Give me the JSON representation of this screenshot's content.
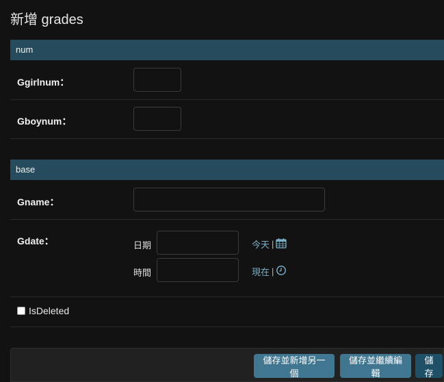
{
  "page": {
    "title": "新增 grades"
  },
  "sections": [
    {
      "header": "num",
      "fields": [
        {
          "label": "Ggirlnum：",
          "value": ""
        },
        {
          "label": "Gboynum：",
          "value": ""
        }
      ]
    },
    {
      "header": "base",
      "fields": [
        {
          "label": "Gname：",
          "value": ""
        },
        {
          "label": "Gdate：",
          "date": {
            "label": "日期",
            "value": "",
            "shortcut": "今天",
            "separator": "|",
            "icon": "calendar-icon"
          },
          "time": {
            "label": "時間",
            "value": "",
            "shortcut": "現在",
            "separator": "|",
            "icon": "clock-icon"
          }
        },
        {
          "label": "IsDeleted",
          "checked": false
        }
      ]
    }
  ],
  "submit": {
    "save_add_another": "儲存並新增另一個",
    "save_continue": "儲存並繼續編輯",
    "save": "儲存"
  },
  "colors": {
    "background": "#121212",
    "section_header": "#264b5d",
    "link": "#79aec8",
    "button": "#417690",
    "button_default": "#205067"
  }
}
